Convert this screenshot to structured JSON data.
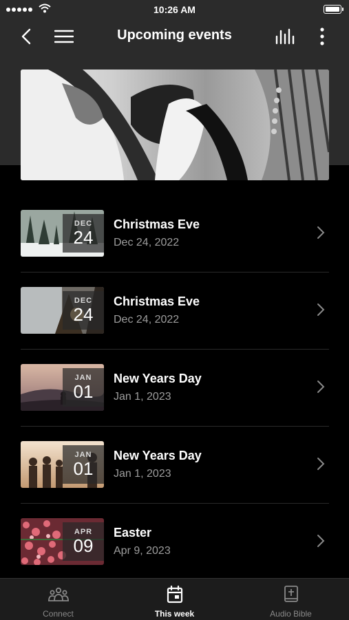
{
  "status_bar": {
    "time": "10:26 AM"
  },
  "nav": {
    "title": "Upcoming events",
    "back_icon": "chevron-left-icon",
    "menu_icon": "hamburger-menu-icon",
    "audio_icon": "audio-bars-icon",
    "more_icon": "more-vertical-icon"
  },
  "hero": {
    "image": "black-and-white clasped hands photo"
  },
  "events": [
    {
      "title": "Christmas Eve",
      "date": "Dec 24, 2022",
      "month": "DEC",
      "day": "24",
      "thumb": "snowy forest"
    },
    {
      "title": "Christmas Eve",
      "date": "Dec 24, 2022",
      "month": "DEC",
      "day": "24",
      "thumb": "foggy sunset trees"
    },
    {
      "title": "New Years Day",
      "date": "Jan 1, 2023",
      "month": "JAN",
      "day": "01",
      "thumb": "mountain sunset with person"
    },
    {
      "title": "New Years Day",
      "date": "Jan 1, 2023",
      "month": "JAN",
      "day": "01",
      "thumb": "group of friends at sunset"
    },
    {
      "title": "Easter",
      "date": "Apr 9, 2023",
      "month": "APR",
      "day": "09",
      "thumb": "tulip field"
    }
  ],
  "tabs": [
    {
      "label": "Connect",
      "icon": "people-icon",
      "active": false
    },
    {
      "label": "This week",
      "icon": "calendar-icon",
      "active": true
    },
    {
      "label": "Audio Bible",
      "icon": "bible-icon",
      "active": false
    }
  ],
  "colors": {
    "background": "#000000",
    "header": "#2b2b2b",
    "tabbar": "#1c1c1c",
    "muted_text": "#9d9d9d"
  }
}
